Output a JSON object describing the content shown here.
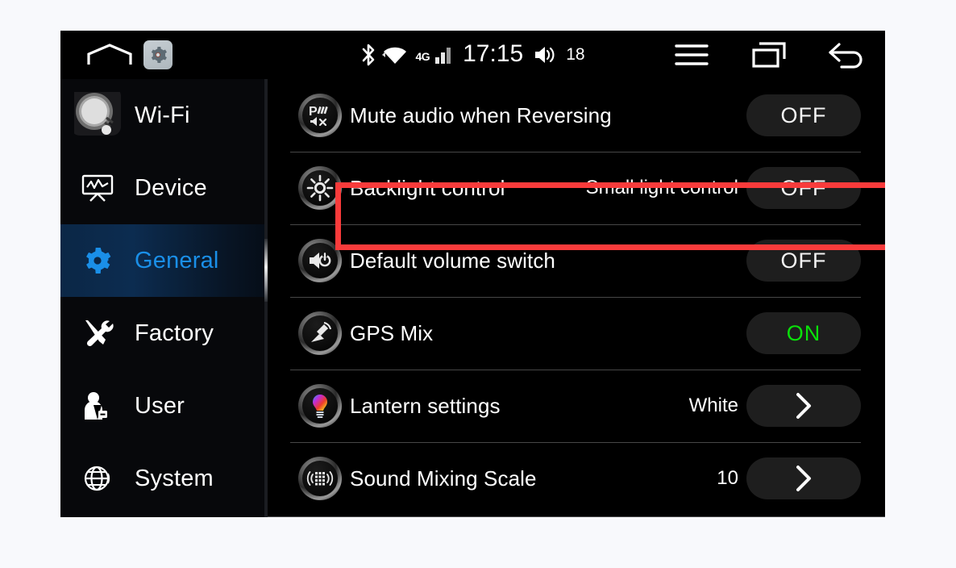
{
  "statusbar": {
    "home_icon": "home-icon",
    "settings_icon": "gear-icon",
    "bluetooth_icon": "bluetooth-icon",
    "wifi_icon": "wifi-icon",
    "network_type": "4G",
    "signal_icon": "signal-bars-icon",
    "time": "17:15",
    "speaker_icon": "speaker-icon",
    "volume": "18",
    "menu_icon": "hamburger-menu-icon",
    "recents_icon": "recent-apps-icon",
    "back_icon": "back-arrow-icon"
  },
  "sidebar": {
    "items": [
      {
        "label": "Wi-Fi",
        "icon": "wifi-dial-icon",
        "active": false
      },
      {
        "label": "Device",
        "icon": "device-monitor-icon",
        "active": false
      },
      {
        "label": "General",
        "icon": "gear-icon",
        "active": true
      },
      {
        "label": "Factory",
        "icon": "tools-icon",
        "active": false
      },
      {
        "label": "User",
        "icon": "user-icon",
        "active": false
      },
      {
        "label": "System",
        "icon": "globe-icon",
        "active": false
      }
    ],
    "active_color": "#1a8fe8"
  },
  "settings": {
    "rows": [
      {
        "label": "Mute audio when Reversing",
        "icon": "parking-mute-icon",
        "value": "",
        "control": "toggle",
        "state": "OFF",
        "highlighted": false
      },
      {
        "label": "Backlight control",
        "icon": "brightness-icon",
        "value": "Small light control",
        "control": "toggle",
        "state": "OFF",
        "highlighted": true
      },
      {
        "label": "Default volume switch",
        "icon": "volume-power-icon",
        "value": "",
        "control": "toggle",
        "state": "OFF",
        "highlighted": false
      },
      {
        "label": "GPS Mix",
        "icon": "gps-antenna-icon",
        "value": "",
        "control": "toggle",
        "state": "ON",
        "highlighted": false
      },
      {
        "label": "Lantern settings",
        "icon": "color-bulb-icon",
        "value": "White",
        "control": "chevron",
        "state": "",
        "highlighted": false
      },
      {
        "label": "Sound Mixing Scale",
        "icon": "equalizer-icon",
        "value": "10",
        "control": "chevron",
        "state": "",
        "highlighted": false
      }
    ],
    "colors": {
      "on": "#0ae00a",
      "off": "#f2f2f2",
      "pill_bg": "#1e1e1e",
      "highlight_box": "#f93b3b"
    }
  }
}
